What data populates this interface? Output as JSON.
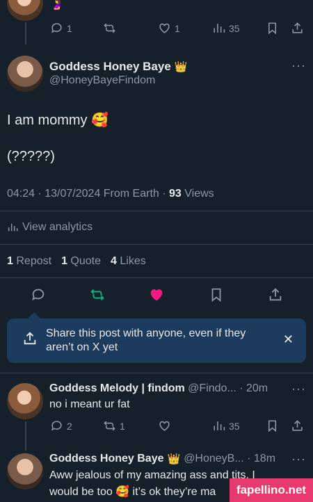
{
  "prev_tweet": {
    "emoji": "🤰",
    "reply_count": "1",
    "like_count": "1",
    "views": "35"
  },
  "main_tweet": {
    "display_name": "Goddess Honey Baye",
    "crown": "👑",
    "handle": "@HoneyBayeFindom",
    "text_line1": "I am mommy 🥰",
    "text_line2": "(?????)",
    "meta_time": "04:24 · 13/07/2024 From Earth ·",
    "meta_views_num": "93",
    "meta_views_label": "Views",
    "analytics": "View analytics",
    "stats": {
      "reposts_num": "1",
      "reposts_label": "Repost",
      "quotes_num": "1",
      "quotes_label": "Quote",
      "likes_num": "4",
      "likes_label": "Likes"
    }
  },
  "share_banner": {
    "text": "Share this post with anyone, even if they aren’t on X yet"
  },
  "reply1": {
    "display_name": "Goddess Melody | findom",
    "handle": "@Findo... · 20m",
    "text": "no i meant ur fat",
    "reply_count": "2",
    "repost_count": "1",
    "views": "35"
  },
  "reply2": {
    "display_name": "Goddess Honey Baye",
    "crown": "👑",
    "handle": "@HoneyB... · 18m",
    "text_line1": "Aww jealous of my amazing ass and tits. I",
    "text_line2": "would be too 🥰 it’s ok they’re ma"
  },
  "watermark": "fapellino.net",
  "colors": {
    "background": "#15202b",
    "like_active": "#f91880",
    "repost_active": "#00ba7c",
    "banner": "#1d3b5c"
  }
}
